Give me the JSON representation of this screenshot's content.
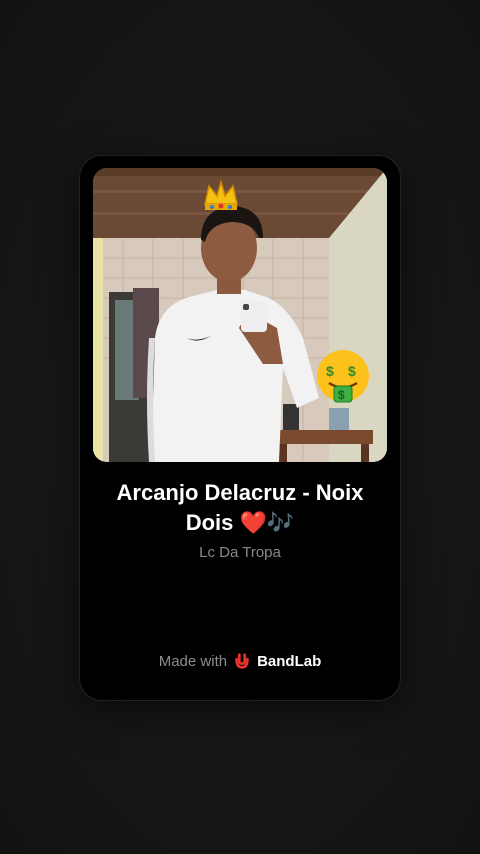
{
  "track": {
    "title": "Arcanjo Delacruz - Noix Dois ❤️🎶",
    "artist": "Lc Da Tropa"
  },
  "footer": {
    "made_with": "Made with",
    "brand": "BandLab"
  },
  "icons": {
    "brand_logo": "bandlab-logo-icon",
    "cover_emoji_top": "crown",
    "cover_emoji_right": "money-mouth-face"
  },
  "colors": {
    "background": "#161616",
    "card": "#000000",
    "title": "#ffffff",
    "artist": "#8a8a8a",
    "brand_red": "#e8332a"
  }
}
